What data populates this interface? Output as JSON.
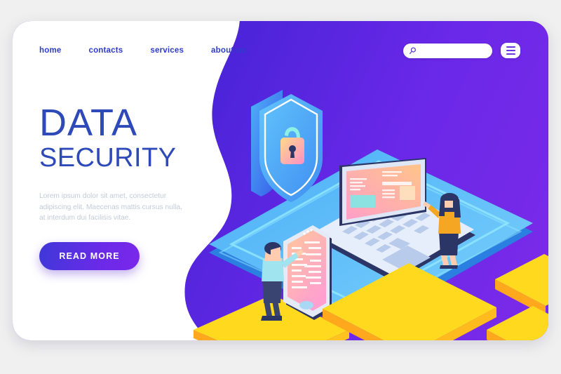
{
  "page": {
    "background_color": "#f0f0f0",
    "card_background": "#ffffff"
  },
  "nav": {
    "items": [
      {
        "label": "home",
        "name": "nav-item-home"
      },
      {
        "label": "contacts",
        "name": "nav-item-contacts"
      },
      {
        "label": "services",
        "name": "nav-item-services"
      },
      {
        "label": "about us",
        "name": "nav-item-about-us"
      }
    ],
    "link_color": "#2e3ccb"
  },
  "search": {
    "value": "",
    "placeholder": "",
    "icon": "search-icon",
    "icon_color": "#5a3ad6"
  },
  "menu": {
    "icon": "hamburger-menu-icon",
    "bar_color": "#6a34e0"
  },
  "hero": {
    "title_line1": "DATA",
    "title_line2": "SECURITY",
    "title_color": "#2e49b8",
    "paragraph": "Lorem ipsum dolor sit amet, consectetur adipiscing elit. Maecenas mattis cursus nulla, at interdum dui facilisis vitae.",
    "paragraph_color": "#c3cbd8",
    "cta_label": "READ MORE",
    "cta_gradient_from": "#3f38d8",
    "cta_gradient_to": "#7b27ea"
  },
  "illustration": {
    "background_gradient_from": "#3a22d6",
    "background_gradient_to": "#7c2ae8",
    "white_blob_color": "#ffffff",
    "shield": {
      "name": "security-shield-icon",
      "face_color": "#54b4f5",
      "edge_color": "#3a74ef",
      "outline_color": "#ffffff",
      "lock_gradient_from": "#ffd98a",
      "lock_gradient_to": "#ff8fc4",
      "lock_shackle_color": "#8ef0e4"
    },
    "platform": {
      "name": "isometric-platform",
      "top_color": "#3ea6f5",
      "top_color_light": "#7cd0fb",
      "side_color": "#2a7fe0",
      "trace_color": "#8fe6ff"
    },
    "laptop": {
      "name": "laptop-device",
      "body_color": "#dfe7f7",
      "screen_gradient_from": "#ff9fc8",
      "screen_gradient_to": "#ffc489",
      "key_color": "#b8cbea"
    },
    "phone": {
      "name": "smartphone-device",
      "body_color": "#e4ebf7",
      "frame_color": "#2b3566",
      "screen_gradient_from": "#ffc79b",
      "screen_gradient_to": "#ff9fd0"
    },
    "woman": {
      "name": "person-woman",
      "hair_color": "#2b3566",
      "top_color": "#f5a623",
      "skirt_color": "#2b3566",
      "skin_color": "#ffccb0"
    },
    "man": {
      "name": "person-man",
      "hair_color": "#2b3566",
      "shirt_color": "#9fe4ee",
      "pants_color": "#3a4470",
      "skin_color": "#ffccb0"
    },
    "blocks": {
      "name": "yellow-blocks",
      "top_color": "#ffd91e",
      "side_color": "#ffa81e"
    }
  }
}
